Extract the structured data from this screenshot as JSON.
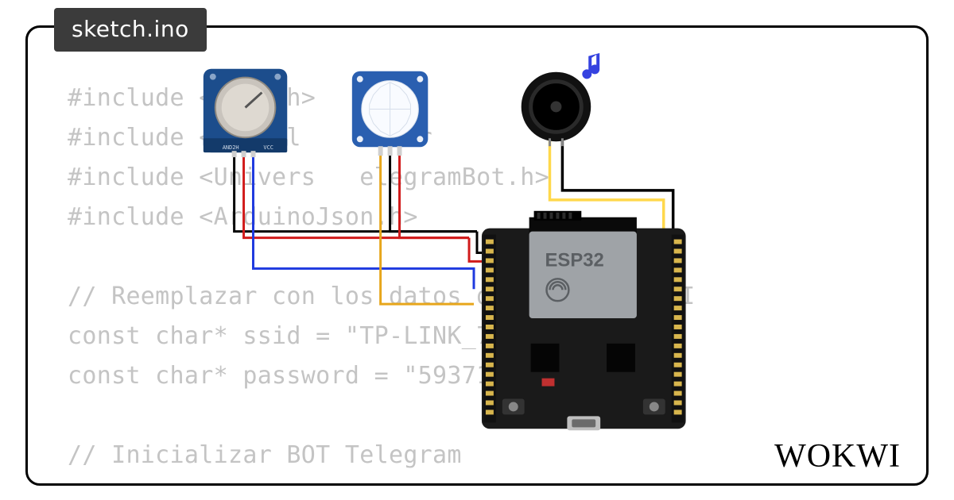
{
  "tab": {
    "filename": "sketch.ino"
  },
  "code": {
    "l1": "#include <WiFi.h>",
    "l2": "#include <WiFiCl    Secur",
    "l3": "#include <Univers   elegramBot.h>",
    "l4": "#include <ArduinoJson.h>",
    "l5": "",
    "l6": "// Reemplazar con los datos de         WIFI",
    "l7": "const char* ssid = \"TP-LINK_78B",
    "l8": "const char* password = \"5937146",
    "l9": "",
    "l10": "// Inicializar BOT Telegram"
  },
  "brand": "WOKWI",
  "components": {
    "gas_sensor": {
      "label_left": "AND2H",
      "label_right": "VCC"
    },
    "pir_sensor": {},
    "buzzer": {
      "playing": true
    },
    "board": {
      "chip_label": "ESP32"
    }
  },
  "wires": {
    "colors": {
      "gnd": "#000000",
      "vcc": "#d11b1b",
      "sig1": "#1f3adf",
      "sig2": "#e7a61b",
      "sig3": "#ffd84b"
    }
  },
  "chart_data": null
}
